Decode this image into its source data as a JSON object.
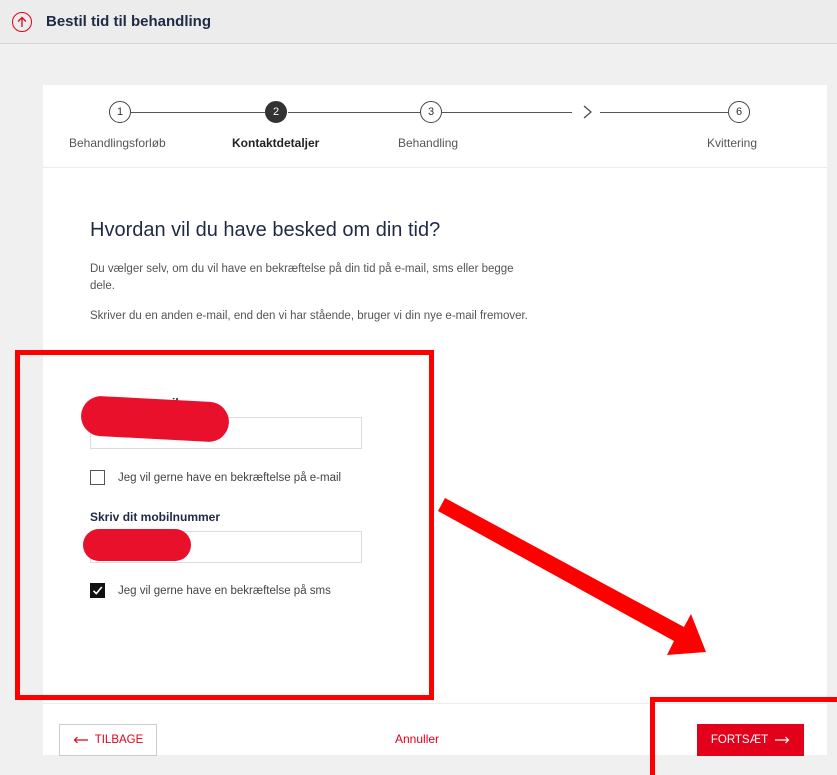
{
  "topbar": {
    "title": "Bestil tid til behandling"
  },
  "steps": [
    {
      "number": "1",
      "label": "Behandlingsforløb"
    },
    {
      "number": "2",
      "label": "Kontaktdetaljer"
    },
    {
      "number": "3",
      "label": "Behandling"
    },
    {
      "number": "6",
      "label": "Kvittering"
    }
  ],
  "form": {
    "heading": "Hvordan vil du have besked om din tid?",
    "paragraph1": "Du vælger selv, om du vil have en bekræftelse på din tid på e-mail, sms eller begge dele.",
    "paragraph2": "Skriver du en anden e-mail, end den vi har stående, bruger vi din nye e-mail fremover.",
    "email_label": "Skriv din e-mail",
    "email_checkbox_label": "Jeg vil gerne have en bekræftelse på e-mail",
    "email_checked": false,
    "phone_label": "Skriv dit mobilnummer",
    "sms_checkbox_label": "Jeg vil gerne have en bekræftelse på sms",
    "sms_checked": true
  },
  "footer": {
    "back_label": "TILBAGE",
    "cancel_label": "Annuller",
    "continue_label": "FORTSÆT"
  },
  "colors": {
    "accent": "#e2001a",
    "annotation": "#ff0000"
  }
}
